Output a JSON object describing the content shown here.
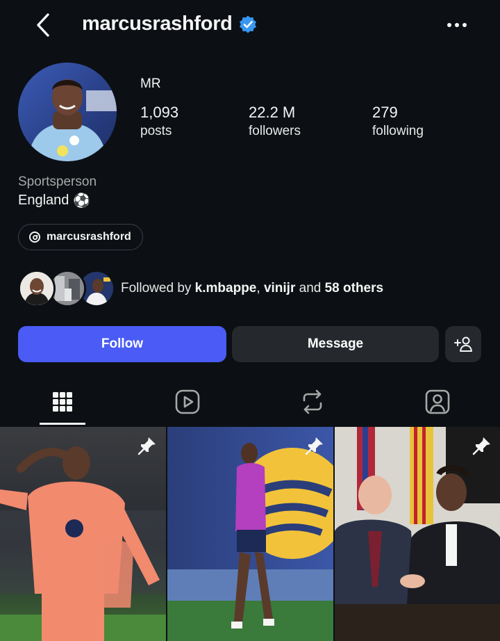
{
  "header": {
    "username": "marcusrashford",
    "back_icon": "chevron-left-icon",
    "verified_icon": "verified-badge-icon",
    "more_icon": "more-horizontal-icon"
  },
  "profile": {
    "display_name": "MR",
    "stats": [
      {
        "value": "1,093",
        "label": "posts"
      },
      {
        "value": "22.2 M",
        "label": "followers"
      },
      {
        "value": "279",
        "label": "following"
      }
    ],
    "category": "Sportsperson",
    "bio": "England",
    "bio_emoji": "⚽"
  },
  "threads": {
    "label": "marcusrashford",
    "icon": "threads-icon"
  },
  "mutuals": {
    "prefix": "Followed by ",
    "user1": "k.mbappe",
    "sep": ", ",
    "user2": "vinijr",
    "and": " and ",
    "others": "58 others"
  },
  "actions": {
    "follow_label": "Follow",
    "message_label": "Message",
    "add_user_icon": "add-person-icon"
  },
  "tabs": [
    {
      "name": "grid-icon",
      "active": true
    },
    {
      "name": "reels-icon",
      "active": false
    },
    {
      "name": "reposts-icon",
      "active": false
    },
    {
      "name": "tagged-icon",
      "active": false
    }
  ],
  "colors": {
    "background": "#0c1014",
    "follow_button": "#4a5cf5",
    "secondary_button": "#25292e",
    "verified": "#3897f0"
  }
}
